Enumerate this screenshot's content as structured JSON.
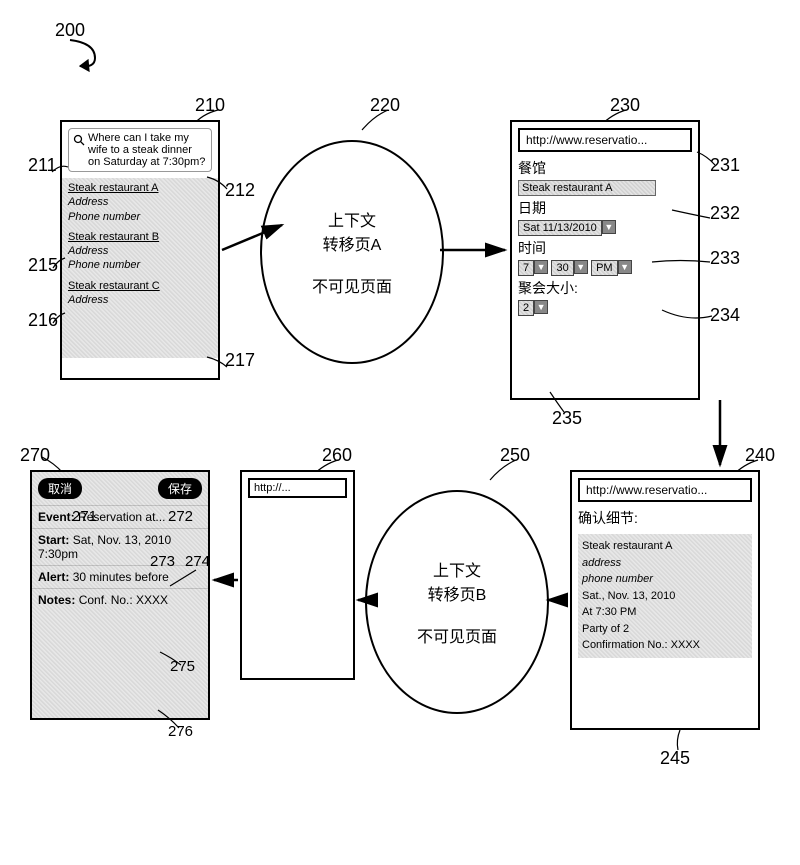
{
  "figure_id": "200",
  "panels": {
    "p210": {
      "ref": "210",
      "search_ref_left": "211",
      "search_ref_right": "212",
      "search_query": "Where can I take my wife to a steak dinner on Saturday at 7:30pm?",
      "results": [
        {
          "ref": "215",
          "name": "Steak restaurant A",
          "addr": "Address",
          "phone": "Phone number"
        },
        {
          "ref": "216",
          "name": "Steak restaurant B",
          "addr": "Address",
          "phone": "Phone number"
        },
        {
          "ref": "217",
          "name": "Steak restaurant C",
          "addr": "Address",
          "phone": ""
        }
      ]
    },
    "p220": {
      "ref": "220",
      "line1": "上下文",
      "line2": "转移页A",
      "line3": "不可见页面"
    },
    "p230": {
      "ref": "230",
      "url_ref": "231",
      "url": "http://www.reservatio...",
      "restaurant_label": "餐馆",
      "restaurant_ref": "232",
      "restaurant_value": "Steak restaurant A",
      "date_label": "日期",
      "date_ref": "233",
      "date_value": "Sat 11/13/2010",
      "time_label": "时间",
      "time_ref": "234",
      "time_h": "7",
      "time_m": "30",
      "time_ampm": "PM",
      "party_label": "聚会大小:",
      "party_ref": "235",
      "party_value": "2"
    },
    "p240": {
      "ref": "240",
      "details_ref": "245",
      "url": "http://www.reservatio...",
      "confirm_label": "确认细节:",
      "lines": [
        "Steak restaurant A",
        "address",
        "phone number",
        "Sat., Nov. 13, 2010",
        "At 7:30 PM",
        "Party of 2",
        "Confirmation No.: XXXX"
      ]
    },
    "p250": {
      "ref": "250",
      "line1": "上下文",
      "line2": "转移页B",
      "line3": "不可见页面"
    },
    "p260": {
      "ref": "260",
      "url": "http://..."
    },
    "p270": {
      "ref": "270",
      "cancel_ref": "271",
      "cancel_label": "取消",
      "save_ref": "272",
      "save_label": "保存",
      "event_ref": "273",
      "event_label": "Event:",
      "event_value": "Reservation at...",
      "start_ref": "274",
      "start_label": "Start:",
      "start_value": "Sat, Nov. 13, 2010 7:30pm",
      "alert_ref": "275",
      "alert_label": "Alert:",
      "alert_value": "30 minutes before",
      "notes_ref": "276",
      "notes_label": "Notes:",
      "notes_value": "Conf. No.: XXXX"
    }
  }
}
